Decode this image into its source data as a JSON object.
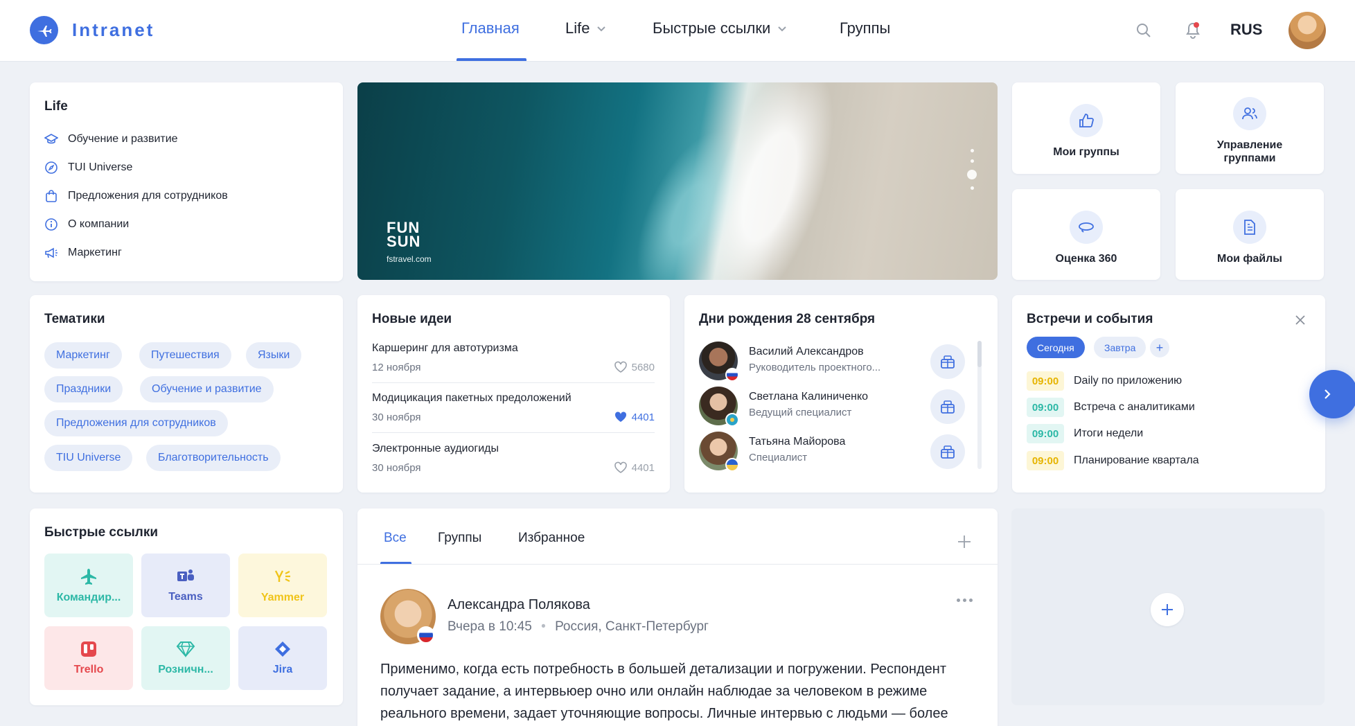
{
  "header": {
    "logo_text": "Intranet",
    "nav": {
      "home": "Главная",
      "life": "Life",
      "quick_links": "Быстрые ссылки",
      "groups": "Группы"
    },
    "lang": "RUS"
  },
  "life": {
    "title": "Life",
    "items": [
      {
        "label": "Обучение и развитие",
        "icon": "graduation-cap-icon"
      },
      {
        "label": "TUI Universe",
        "icon": "compass-icon"
      },
      {
        "label": "Предложения для сотрудников",
        "icon": "shopping-bag-icon"
      },
      {
        "label": "О компании",
        "icon": "info-icon"
      },
      {
        "label": "Маркетинг",
        "icon": "megaphone-icon"
      }
    ]
  },
  "banner": {
    "brand_line1": "FUN",
    "brand_line2": "SUN",
    "brand_url": "fstravel.com"
  },
  "tiles": {
    "my_groups": "Мои группы",
    "manage_groups": "Управление группами",
    "rating360": "Оценка 360",
    "my_files": "Мои файлы"
  },
  "topics": {
    "title": "Тематики",
    "chips": [
      "Маркетинг",
      "Путешествия",
      "Языки",
      "Праздники",
      "Обучение и развитие",
      "Предложения для сотрудников",
      "TIU Universe",
      "Благотворительность"
    ]
  },
  "ideas": {
    "title": "Новые идеи",
    "items": [
      {
        "title": "Каршеринг для автотуризма",
        "date": "12 ноября",
        "likes": "5680",
        "liked": false
      },
      {
        "title": "Модицикация пакетных предоложений",
        "date": "30 ноября",
        "likes": "4401",
        "liked": true
      },
      {
        "title": "Электронные аудиогиды",
        "date": "30 ноября",
        "likes": "4401",
        "liked": false
      }
    ]
  },
  "birthdays": {
    "title": "Дни рождения 28 сентября",
    "people": [
      {
        "name": "Василий Александров",
        "role": "Руководитель проектного..."
      },
      {
        "name": "Светлана Калиниченко",
        "role": "Ведущий специалист"
      },
      {
        "name": "Татьяна Майорова",
        "role": "Специалист"
      }
    ]
  },
  "events": {
    "title": "Встречи и события",
    "today": "Сегодня",
    "tomorrow": "Завтра",
    "add": "+",
    "items": [
      {
        "time": "09:00",
        "title": "Daily по приложению",
        "color": "#e6b400"
      },
      {
        "time": "09:00",
        "title": "Встреча с аналитиками",
        "color": "#2cb8a6"
      },
      {
        "time": "09:00",
        "title": "Итоги недели",
        "color": "#2cb8a6"
      },
      {
        "time": "09:00",
        "title": "Планирование квартала",
        "color": "#e6b400"
      }
    ]
  },
  "quick_links": {
    "title": "Быстрые ссылки",
    "items": [
      {
        "label": "Командир...",
        "color": "#2cb8a6",
        "icon": "airplane-icon"
      },
      {
        "label": "Teams",
        "color": "#4a5fc1",
        "icon": "teams-icon"
      },
      {
        "label": "Yammer",
        "color": "#f0c419",
        "icon": "yammer-icon"
      },
      {
        "label": "Trello",
        "color": "#e5484d",
        "icon": "trello-icon"
      },
      {
        "label": "Розничн...",
        "color": "#2cb8a6",
        "icon": "diamond-icon"
      },
      {
        "label": "Jira",
        "color": "#3f6fe0",
        "icon": "jira-icon"
      }
    ]
  },
  "feed": {
    "tabs": [
      "Все",
      "Группы",
      "Избранное"
    ],
    "post": {
      "author": "Александра Полякова",
      "time": "Вчера в 10:45",
      "location": "Россия, Санкт-Петербург",
      "text": "Применимо, когда есть потребность в большей детализации и погружении. Респондент получает задание, а интервьюер очно или онлайн наблюдае за человеком в режиме реального времени, задает уточняющие вопросы. Личные интервью с людьми — более"
    }
  },
  "colors": {
    "accent": "#3f6fe0",
    "background": "#eef1f6"
  }
}
